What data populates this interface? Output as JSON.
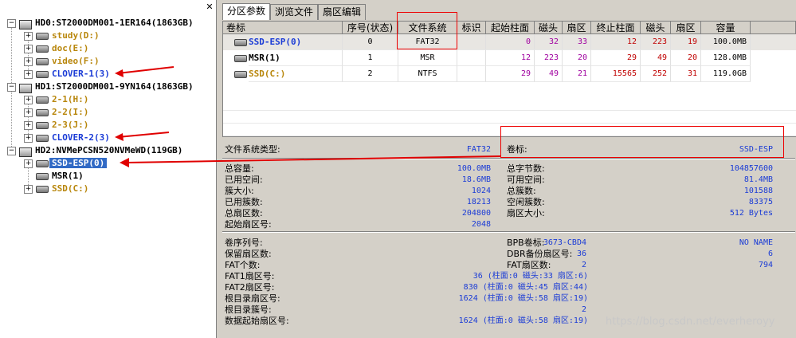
{
  "tree": {
    "close_glyph": "✕",
    "disks": [
      {
        "label": "HD0:ST2000DM001-1ER164(1863GB)",
        "volumes": [
          "study(D:)",
          "doc(E:)",
          "video(F:)",
          "CLOVER-1(3)"
        ]
      },
      {
        "label": "HD1:ST2000DM001-9YN164(1863GB)",
        "volumes": [
          "2-1(H:)",
          "2-2(I:)",
          "2-3(J:)",
          "CLOVER-2(3)"
        ]
      },
      {
        "label": "HD2:NVMePCSN520NVMeWD(119GB)",
        "volumes": [
          "SSD-ESP(0)",
          "MSR(1)",
          "SSD(C:)"
        ]
      }
    ]
  },
  "tabs": [
    "分区参数",
    "浏览文件",
    "扇区编辑"
  ],
  "table": {
    "headers": [
      "卷标",
      "序号(状态)",
      "文件系统",
      "标识",
      "起始柱面",
      "磁头",
      "扇区",
      "终止柱面",
      "磁头",
      "扇区",
      "容量"
    ],
    "rows": [
      [
        "SSD-ESP(0)",
        "0",
        "FAT32",
        "",
        "0",
        "32",
        "33",
        "12",
        "223",
        "19",
        "100.0MB"
      ],
      [
        "MSR(1)",
        "1",
        "MSR",
        "",
        "12",
        "223",
        "20",
        "29",
        "49",
        "20",
        "128.0MB"
      ],
      [
        "SSD(C:)",
        "2",
        "NTFS",
        "",
        "29",
        "49",
        "21",
        "15565",
        "252",
        "31",
        "119.0GB"
      ]
    ]
  },
  "info": {
    "fs_type_label": "文件系统类型:",
    "fs_type_value": "FAT32",
    "vol_label": "卷标:",
    "vol_value": "SSD-ESP",
    "left1": [
      [
        "总容量:",
        "100.0MB"
      ],
      [
        "已用空间:",
        "18.6MB"
      ],
      [
        "簇大小:",
        "1024"
      ],
      [
        "已用簇数:",
        "18213"
      ],
      [
        "总扇区数:",
        "204800"
      ],
      [
        "起始扇区号:",
        "2048"
      ]
    ],
    "right1": [
      [
        "总字节数:",
        "104857600"
      ],
      [
        "可用空间:",
        "81.4MB"
      ],
      [
        "总簇数:",
        "101588"
      ],
      [
        "空闲簇数:",
        "83375"
      ],
      [
        "扇区大小:",
        "512 Bytes"
      ]
    ],
    "left2": [
      [
        "卷序列号:",
        "3673-CBD4"
      ],
      [
        "保留扇区数:",
        "36"
      ],
      [
        "FAT个数:",
        "2"
      ],
      [
        "FAT1扇区号:",
        "36 (柱面:0 磁头:33 扇区:6)"
      ],
      [
        "FAT2扇区号:",
        "830 (柱面:0 磁头:45 扇区:44)"
      ],
      [
        "根目录扇区号:",
        "1624 (柱面:0 磁头:58 扇区:19)"
      ],
      [
        "根目录簇号:",
        "2"
      ],
      [
        "数据起始扇区号:",
        "1624 (柱面:0 磁头:58 扇区:19)"
      ]
    ],
    "right2": [
      [
        "BPB卷标:",
        "NO NAME"
      ],
      [
        "DBR备份扇区号:",
        "6"
      ],
      [
        "FAT扇区数:",
        "794"
      ]
    ]
  },
  "watermark": "https://blog.csdn.net/everheroyy",
  "colors": {
    "accent_red": "#e00000",
    "link_blue": "#1a3bd6",
    "volume_gold": "#b8860b",
    "selected": "#316ac5"
  }
}
